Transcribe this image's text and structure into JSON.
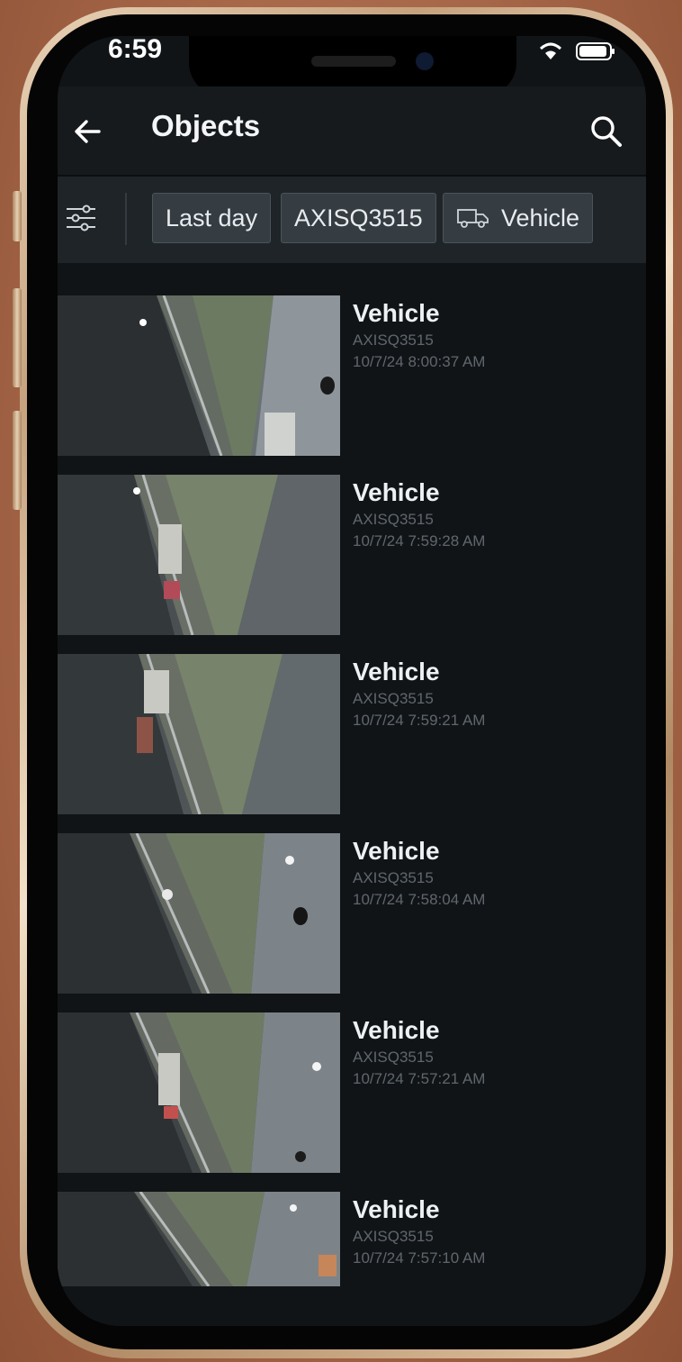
{
  "status_bar": {
    "time": "6:59"
  },
  "header": {
    "title": "Objects",
    "back_icon": "arrow-left-icon",
    "search_icon": "search-icon"
  },
  "filters": {
    "settings_icon": "sliders-icon",
    "chips": [
      {
        "label": "Last day"
      },
      {
        "label": "AXISQ3515"
      },
      {
        "label": "Vehicle",
        "icon": "truck-icon"
      }
    ]
  },
  "results": [
    {
      "title": "Vehicle",
      "camera": "AXISQ3515",
      "timestamp": "10/7/24 8:00:37 AM"
    },
    {
      "title": "Vehicle",
      "camera": "AXISQ3515",
      "timestamp": "10/7/24 7:59:28 AM"
    },
    {
      "title": "Vehicle",
      "camera": "AXISQ3515",
      "timestamp": "10/7/24 7:59:21 AM"
    },
    {
      "title": "Vehicle",
      "camera": "AXISQ3515",
      "timestamp": "10/7/24 7:58:04 AM"
    },
    {
      "title": "Vehicle",
      "camera": "AXISQ3515",
      "timestamp": "10/7/24 7:57:21 AM"
    },
    {
      "title": "Vehicle",
      "camera": "AXISQ3515",
      "timestamp": "10/7/24 7:57:10 AM"
    }
  ],
  "colors": {
    "background": "#111417",
    "header": "#161a1d",
    "filter_bar": "#1e2428",
    "chip": "#353d43",
    "text_primary": "#eef1f3",
    "text_secondary": "#5f676d"
  }
}
